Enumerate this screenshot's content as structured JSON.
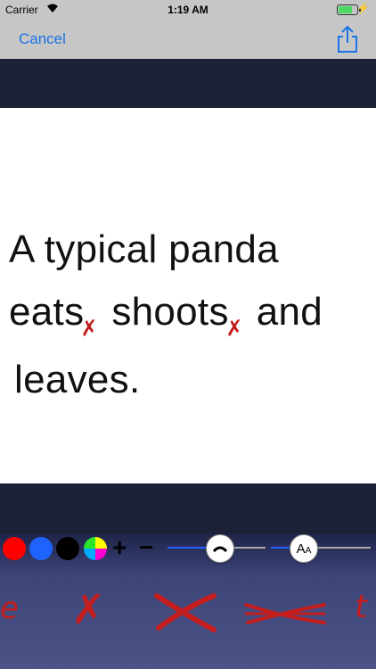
{
  "status_bar": {
    "carrier": "Carrier",
    "time": "1:19 AM",
    "battery_color": "#4cd964"
  },
  "nav": {
    "cancel_label": "Cancel",
    "share_icon": "share-icon",
    "accent": "#1a73e8"
  },
  "document": {
    "line1": "A typical panda",
    "line2_a": "eats",
    "line2_b": " shoots",
    "line2_c": " and",
    "line3": "leaves.",
    "delete_mark": "✗"
  },
  "toolbar": {
    "colors": [
      "#ff0000",
      "#1f63ff",
      "#000000",
      "multicolor"
    ],
    "plus_label": "+",
    "minus_label": "−",
    "stroke_slider_value": 0.5,
    "size_slider_value": 0.33,
    "font_size_glyph": "AA"
  },
  "marks": [
    "e",
    "✗",
    "✕",
    "⟗",
    "t"
  ]
}
